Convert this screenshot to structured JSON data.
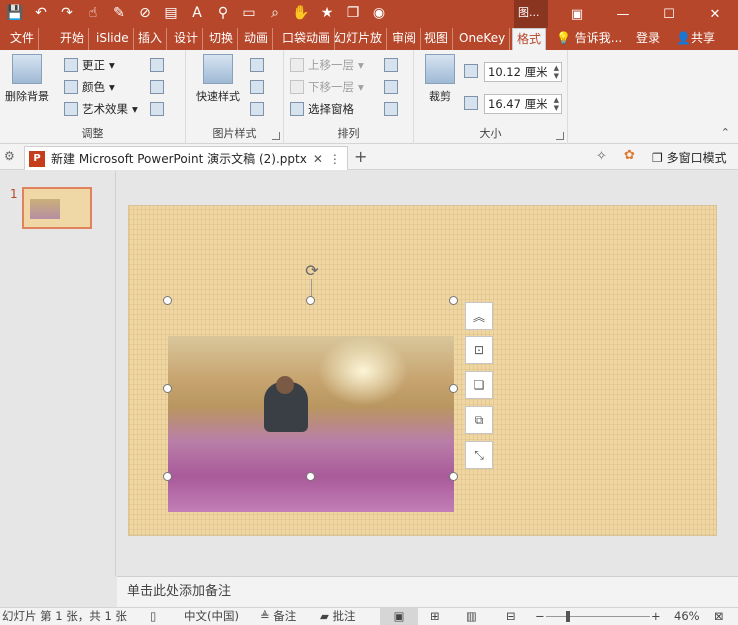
{
  "titlebar": {
    "context_tab": "图...",
    "window_controls": [
      "ribbon-display-icon",
      "minimize-icon",
      "restore-icon",
      "close-icon"
    ]
  },
  "tabs": {
    "file": "文件",
    "home": "开始",
    "islide": "iSlide",
    "insert": "插入",
    "design": "设计",
    "transitions": "切换",
    "animations": "动画",
    "pocket": "口袋动画",
    "slideshow": "幻灯片放",
    "review": "审阅",
    "view": "视图",
    "onekey": "OneKey",
    "format": "格式",
    "tellme": "告诉我...",
    "login": "登录",
    "share": "共享"
  },
  "ribbon": {
    "remove_bg": "删除背景",
    "corrections": "更正",
    "color": "颜色",
    "artistic": "艺术效果",
    "adjust_group": "调整",
    "quick_styles": "快速样式",
    "picture_styles_group": "图片样式",
    "bring_forward": "上移一层",
    "send_backward": "下移一层",
    "selection_pane": "选择窗格",
    "arrange_group": "排列",
    "crop": "裁剪",
    "height": "10.12 厘米",
    "width": "16.47 厘米",
    "size_group": "大小"
  },
  "docbar": {
    "filename": "新建 Microsoft PowerPoint 演示文稿 (2).pptx",
    "close_mark": "✕",
    "more_mark": "⋮",
    "add_mark": "+",
    "multi_window": "多窗口模式"
  },
  "thumbnails": {
    "number": "1"
  },
  "notes": {
    "placeholder": "单击此处添加备注"
  },
  "status": {
    "slide_info": "幻灯片 第 1 张，共 1 张",
    "language": "中文(中国)",
    "notes_btn": "备注",
    "comments_btn": "批注",
    "zoom": "46%",
    "zoom_minus": "−",
    "zoom_plus": "+"
  }
}
